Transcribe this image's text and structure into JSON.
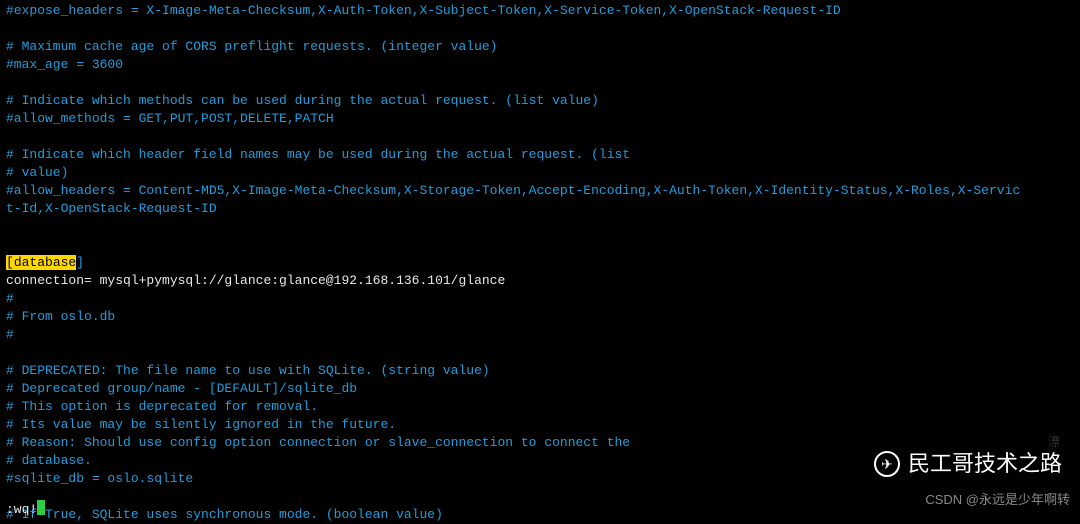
{
  "editor": {
    "lines": [
      {
        "cls": "comment",
        "text": "#expose_headers = X-Image-Meta-Checksum,X-Auth-Token,X-Subject-Token,X-Service-Token,X-OpenStack-Request-ID"
      },
      {
        "cls": "comment",
        "text": ""
      },
      {
        "cls": "comment",
        "text": "# Maximum cache age of CORS preflight requests. (integer value)"
      },
      {
        "cls": "comment",
        "text": "#max_age = 3600"
      },
      {
        "cls": "comment",
        "text": ""
      },
      {
        "cls": "comment",
        "text": "# Indicate which methods can be used during the actual request. (list value)"
      },
      {
        "cls": "comment",
        "text": "#allow_methods = GET,PUT,POST,DELETE,PATCH"
      },
      {
        "cls": "comment",
        "text": ""
      },
      {
        "cls": "comment",
        "text": "# Indicate which header field names may be used during the actual request. (list"
      },
      {
        "cls": "comment",
        "text": "# value)"
      },
      {
        "cls": "comment",
        "text": "#allow_headers = Content-MD5,X-Image-Meta-Checksum,X-Storage-Token,Accept-Encoding,X-Auth-Token,X-Identity-Status,X-Roles,X-Servic"
      },
      {
        "cls": "comment",
        "text": "t-Id,X-OpenStack-Request-ID"
      },
      {
        "cls": "comment",
        "text": ""
      },
      {
        "cls": "comment",
        "text": ""
      }
    ],
    "section_line": {
      "open": "[",
      "label": "database",
      "close": "]"
    },
    "after_section": [
      {
        "cls": "normal",
        "text": "connection= mysql+pymysql://glance:glance@192.168.136.101/glance"
      },
      {
        "cls": "comment",
        "text": "#"
      },
      {
        "cls": "comment",
        "text": "# From oslo.db"
      },
      {
        "cls": "comment",
        "text": "#"
      },
      {
        "cls": "comment",
        "text": ""
      },
      {
        "cls": "comment",
        "text": "# DEPRECATED: The file name to use with SQLite. (string value)"
      },
      {
        "cls": "comment",
        "text": "# Deprecated group/name - [DEFAULT]/sqlite_db"
      },
      {
        "cls": "comment",
        "text": "# This option is deprecated for removal."
      },
      {
        "cls": "comment",
        "text": "# Its value may be silently ignored in the future."
      },
      {
        "cls": "comment",
        "text": "# Reason: Should use config option connection or slave_connection to connect the"
      },
      {
        "cls": "comment",
        "text": "# database."
      },
      {
        "cls": "comment",
        "text": "#sqlite_db = oslo.sqlite"
      },
      {
        "cls": "comment",
        "text": ""
      },
      {
        "cls": "comment",
        "text": "# If True, SQLite uses synchronous mode. (boolean value)"
      }
    ],
    "status_cmd": ":wq!"
  },
  "watermarks": {
    "main": "民工哥技术之路",
    "sub": "CSDN @永远是少年啊转",
    "faint": "漂"
  }
}
